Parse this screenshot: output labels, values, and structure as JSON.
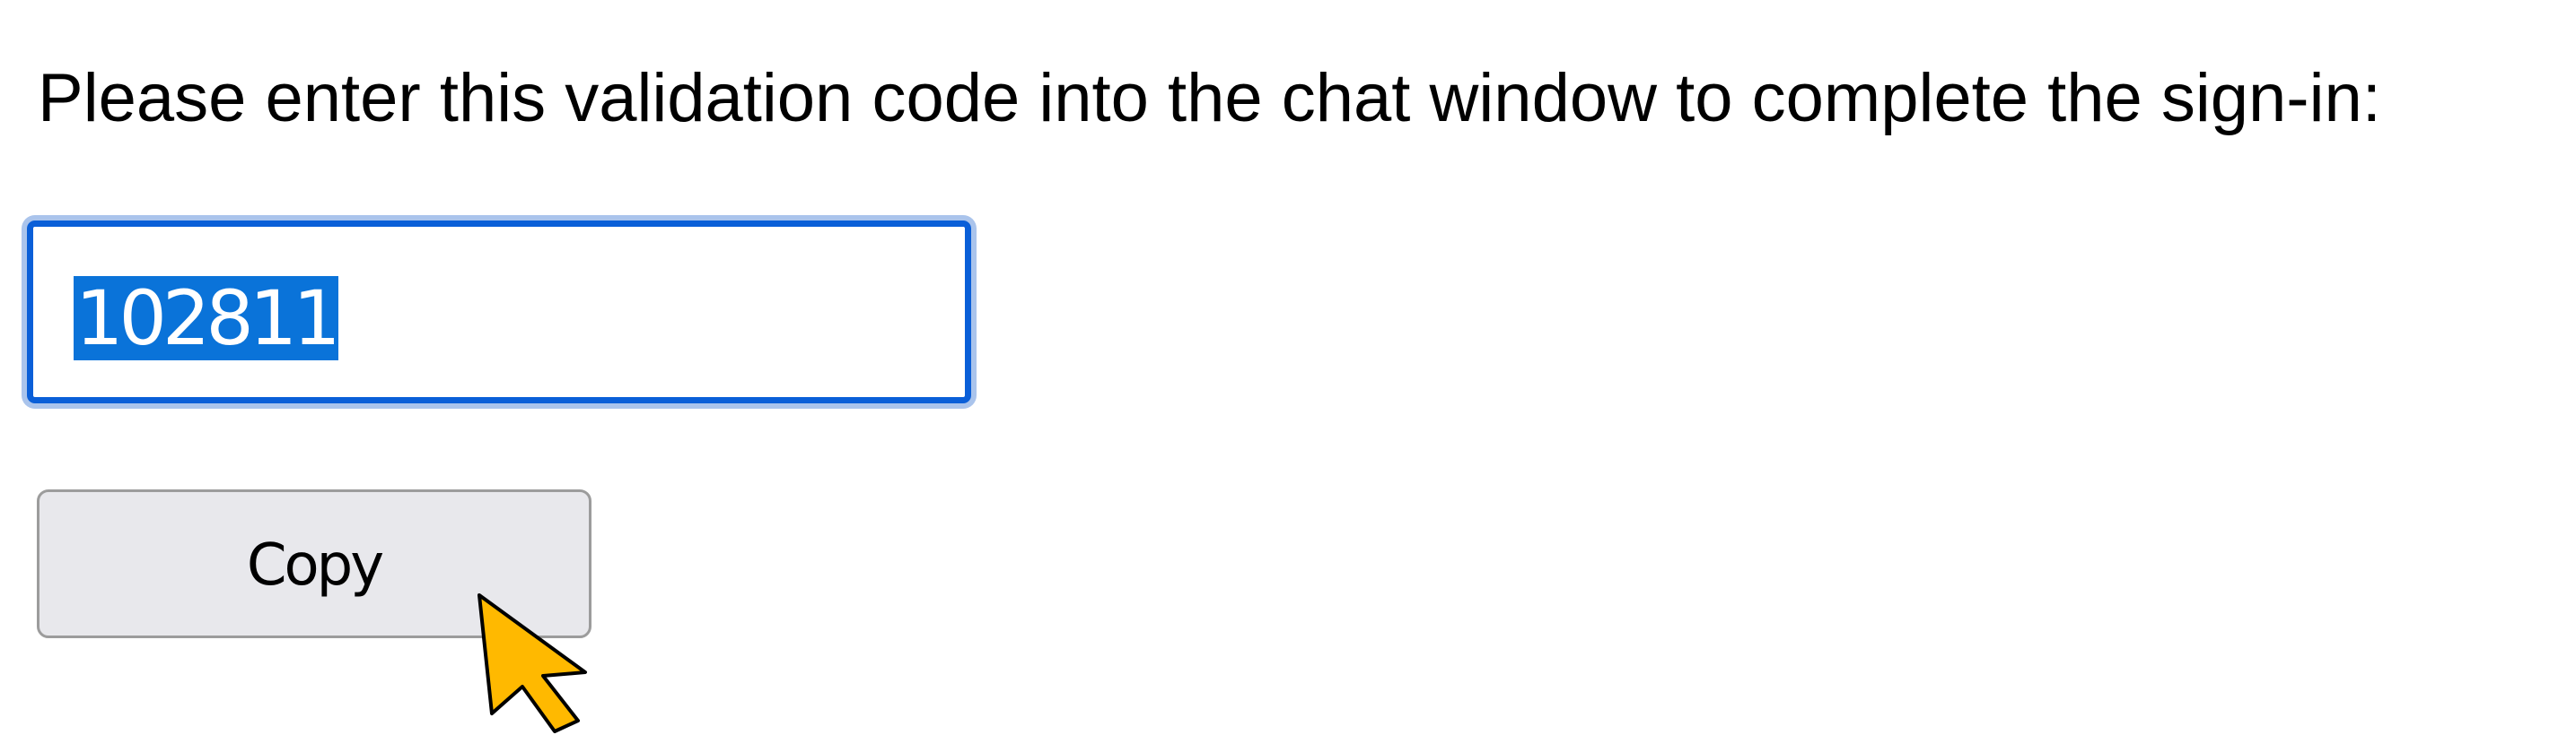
{
  "prompt": {
    "text": "Please enter this validation code into the chat window to complete the sign-in:"
  },
  "code": {
    "value": "102811",
    "selected": true
  },
  "copy_button": {
    "label": "Copy"
  },
  "cursor": {
    "icon": "arrow-pointer-icon",
    "color": "#ffb900"
  },
  "colors": {
    "focus_border": "#0a5fd8",
    "selection": "#0a73d9",
    "button_background": "#e8e8ec"
  }
}
